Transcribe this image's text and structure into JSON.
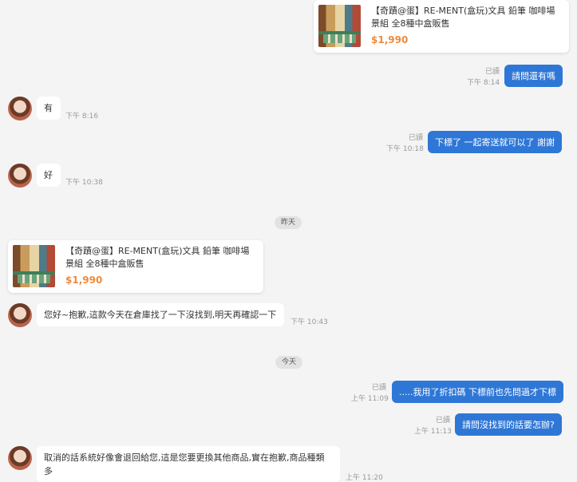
{
  "messages": {
    "product_card_1": {
      "title": "【奇蹟@蛋】RE-MENT(盒玩)文具 鉛筆 咖啡場景組 全8種中盒販售",
      "price": "$1,990"
    },
    "m1": {
      "read": "已讀",
      "time": "下午 8:14",
      "text": "請問還有嗎"
    },
    "m2": {
      "text": "有",
      "time": "下午 8:16"
    },
    "m3": {
      "read": "已讀",
      "time": "下午 10:18",
      "text": "下標了 一起寄送就可以了 謝謝"
    },
    "m4": {
      "text": "好",
      "time": "下午 10:38"
    },
    "divider_yesterday": "昨天",
    "product_card_2": {
      "title": "【奇蹟@蛋】RE-MENT(盒玩)文具 鉛筆 咖啡場景組 全8種中盒販售",
      "price": "$1,990"
    },
    "m5": {
      "text": "您好~抱歉,這款今天在倉庫找了一下沒找到,明天再確認一下",
      "time": "下午 10:43"
    },
    "divider_today": "今天",
    "m6": {
      "read": "已讀",
      "time": "上午 11:09",
      "text": ".....我用了折扣碼 下標前也先問過才下標"
    },
    "m7": {
      "read": "已讀",
      "time": "上午 11:13",
      "text": "請問沒找到的話要怎辦?"
    },
    "m8": {
      "text": "取消的話系統好像會退回給您,這是您要更換其他商品,實在抱歉,商品種類多",
      "time": "上午 11:20"
    }
  }
}
